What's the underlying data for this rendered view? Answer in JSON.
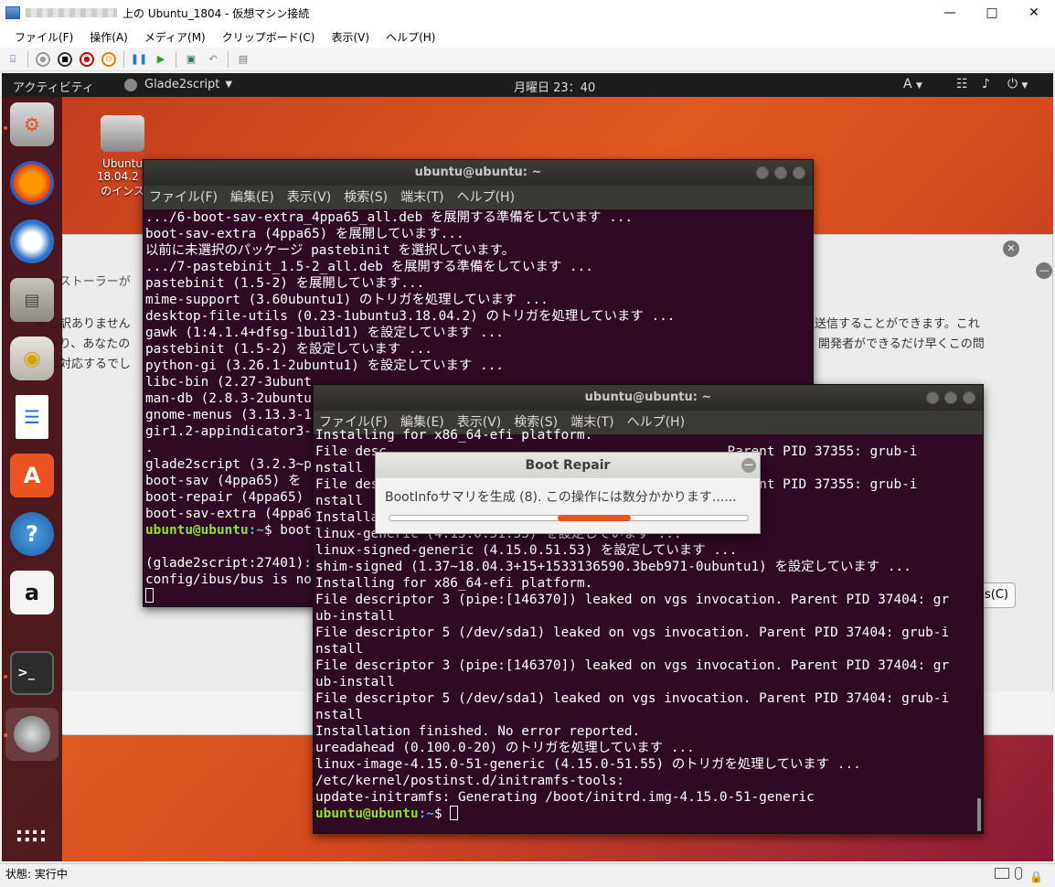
{
  "hyperv": {
    "title": "上の Ubuntu_1804 - 仮想マシン接続",
    "menu": [
      "ファイル(F)",
      "操作(A)",
      "メディア(M)",
      "クリップボード(C)",
      "表示(V)",
      "ヘルプ(H)"
    ],
    "status": "状態: 実行中"
  },
  "gnome": {
    "activities": "アクティビティ",
    "app_name": "Glade2script",
    "clock": "月曜日 23：40",
    "input_method": "A"
  },
  "desktop_icon": {
    "lines": [
      "Ubuntu",
      "18.04.2 L",
      "のインス"
    ]
  },
  "installer": {
    "title_partial": "インストーラーが",
    "line1_left": "申し訳ありません",
    "line1_right": "送信することができます。これ",
    "line2_left": "により、あなたの",
    "line2_right": "開発者ができるだけ早くこの問",
    "line3_left": "題に対応するでし",
    "button_partial": "s(C)"
  },
  "term1": {
    "title": "ubuntu@ubuntu: ~",
    "menu": [
      "ファイル(F)",
      "編集(E)",
      "表示(V)",
      "検索(S)",
      "端末(T)",
      "ヘルプ(H)"
    ],
    "lines": [
      ".../6-boot-sav-extra_4ppa65_all.deb を展開する準備をしています ...",
      "boot-sav-extra (4ppa65) を展開しています...",
      "以前に未選択のパッケージ pastebinit を選択しています。",
      ".../7-pastebinit_1.5-2_all.deb を展開する準備をしています ...",
      "pastebinit (1.5-2) を展開しています...",
      "mime-support (3.60ubuntu1) のトリガを処理しています ...",
      "desktop-file-utils (0.23-1ubuntu3.18.04.2) のトリガを処理しています ...",
      "gawk (1:4.1.4+dfsg-1build1) を設定しています ...",
      "pastebinit (1.5-2) を設定しています ...",
      "python-gi (3.26.1-2ubuntu1) を設定しています ...",
      "libc-bin (2.27-3ubunt",
      "man-db (2.8.3-2ubuntu",
      "gnome-menus (3.13.3-1",
      "gir1.2-appindicator3-",
      ".",
      "glade2script (3.2.3~p",
      "boot-sav (4ppa65) を",
      "boot-repair (4ppa65)",
      "boot-sav-extra (4ppa6"
    ],
    "prompt_user": "ubuntu@ubuntu",
    "prompt_path": ":~$ boot",
    "tail1": "",
    "tail2": "(glade2script:27401):",
    "tail3": "config/ibus/bus is no"
  },
  "term2": {
    "title": "ubuntu@ubuntu: ~",
    "menu": [
      "ファイル(F)",
      "編集(E)",
      "表示(V)",
      "検索(S)",
      "端末(T)",
      "ヘルプ(H)"
    ],
    "lines": [
      "Installing for x86_64-efi platform.",
      "File desc                                         . Parent PID 37355: grub-i",
      "nstall",
      "File des                                          . Parent PID 37355: grub-i",
      "nstall",
      "Installa",
      "linux-generic (4.15.0.51.53) を設定しています ...",
      "linux-signed-generic (4.15.0.51.53) を設定しています ...",
      "shim-signed (1.37~18.04.3+15+1533136590.3beb971-0ubuntu1) を設定しています ...",
      "Installing for x86_64-efi platform.",
      "File descriptor 3 (pipe:[146370]) leaked on vgs invocation. Parent PID 37404: gr",
      "ub-install",
      "File descriptor 5 (/dev/sda1) leaked on vgs invocation. Parent PID 37404: grub-i",
      "nstall",
      "File descriptor 3 (pipe:[146370]) leaked on vgs invocation. Parent PID 37404: gr",
      "ub-install",
      "File descriptor 5 (/dev/sda1) leaked on vgs invocation. Parent PID 37404: grub-i",
      "nstall",
      "Installation finished. No error reported.",
      "ureadahead (0.100.0-20) のトリガを処理しています ...",
      "linux-image-4.15.0-51-generic (4.15.0-51.55) のトリガを処理しています ...",
      "/etc/kernel/postinst.d/initramfs-tools:",
      "update-initramfs: Generating /boot/initrd.img-4.15.0-51-generic"
    ],
    "prompt_user": "ubuntu@ubuntu",
    "prompt_path": ":~$ "
  },
  "boot_repair": {
    "title": "Boot Repair",
    "message": "BootInfoサマリを生成 (8). この操作には数分かかります......",
    "progress_fraction": 0.2
  },
  "dock_icons": [
    "boot-repair-drive-icon",
    "firefox-icon",
    "thunderbird-icon",
    "files-icon",
    "rhythmbox-icon",
    "libreoffice-writer-icon",
    "software-center-icon",
    "help-icon",
    "amazon-icon",
    "terminal-icon",
    "boot-repair-icon",
    "app-grid-icon"
  ]
}
